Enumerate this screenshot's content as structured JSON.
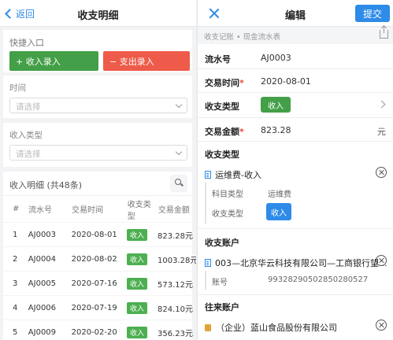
{
  "left": {
    "header": {
      "back_label": "返回",
      "title": "收支明细"
    },
    "quick_entry": {
      "label": "快捷入口",
      "income_button": "+ 收入录入",
      "expense_button": "− 支出录入"
    },
    "time_filter": {
      "label": "时间",
      "placeholder": "请选择"
    },
    "income_type_filter": {
      "label": "收入类型",
      "placeholder": "请选择"
    },
    "table": {
      "title": "收入明细 (共48条)",
      "columns": [
        "#",
        "流水号",
        "交易时间",
        "收支类型",
        "交易金额"
      ],
      "rows": [
        {
          "no": "1",
          "id": "AJ0003",
          "date": "2020-08-01",
          "type": "收入",
          "amount": "823.28元"
        },
        {
          "no": "2",
          "id": "AJ0004",
          "date": "2020-08-02",
          "type": "收入",
          "amount": "1003.28元"
        },
        {
          "no": "3",
          "id": "AJ0005",
          "date": "2020-07-16",
          "type": "收入",
          "amount": "573.12元"
        },
        {
          "no": "4",
          "id": "AJ0006",
          "date": "2020-07-19",
          "type": "收入",
          "amount": "824.10元"
        },
        {
          "no": "5",
          "id": "AJ0009",
          "date": "2020-02-20",
          "type": "收入",
          "amount": "356.23元"
        }
      ]
    }
  },
  "right": {
    "header": {
      "title": "编辑",
      "submit_label": "提交"
    },
    "breadcrumb": "收支记账 • 现金流水表",
    "fields": {
      "serial": {
        "label": "流水号",
        "value": "AJ0003"
      },
      "time": {
        "label": "交易时间",
        "required_mark": "*",
        "value": "2020-08-01"
      },
      "type": {
        "label": "收支类型",
        "value": "收入"
      },
      "amount": {
        "label": "交易金额",
        "required_mark": "*",
        "value": "823.28",
        "unit": "元"
      }
    },
    "type_section": {
      "title": "收支类型",
      "item": "运维费-收入",
      "subject_label": "科目类型",
      "subject_value": "运维费",
      "kind_label": "收支类型",
      "kind_value": "收入"
    },
    "account_section": {
      "title": "收支账户",
      "item": "003—北京华云科技有限公司—工商银行望...",
      "account_label": "账号",
      "account_value": "9932829050285028052​7"
    },
    "partner_section": {
      "title": "往来账户",
      "item": "（企业）蓝山食品股份有限公司"
    }
  }
}
